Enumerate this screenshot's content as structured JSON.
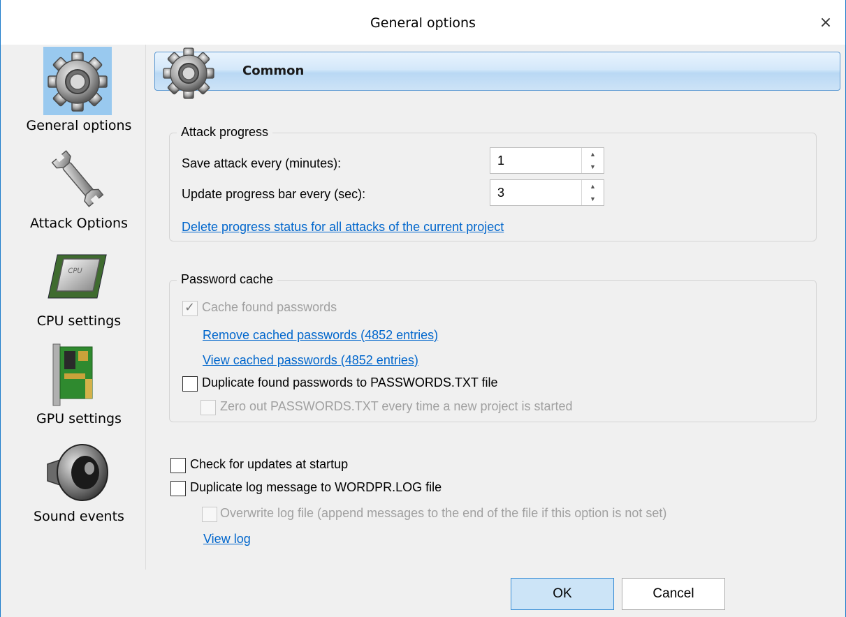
{
  "window": {
    "title": "General options",
    "close_glyph": "×"
  },
  "sidebar": {
    "items": [
      {
        "label": "General options",
        "icon": "gear-icon",
        "selected": true
      },
      {
        "label": "Attack Options",
        "icon": "wrench-icon",
        "selected": false
      },
      {
        "label": "CPU settings",
        "icon": "cpu-chip-icon",
        "selected": false
      },
      {
        "label": "GPU settings",
        "icon": "gpu-card-icon",
        "selected": false
      },
      {
        "label": "Sound events",
        "icon": "speaker-icon",
        "selected": false
      }
    ]
  },
  "header": {
    "title": "Common",
    "icon": "gear-icon"
  },
  "attack_progress": {
    "legend": "Attack progress",
    "save_label": "Save attack every (minutes):",
    "save_value": "1",
    "update_label": "Update progress bar every (sec):",
    "update_value": "3",
    "delete_link": "Delete progress status for all attacks of the current project"
  },
  "password_cache": {
    "legend": "Password cache",
    "cache_found_label": "Cache found passwords",
    "cache_found_checked": true,
    "remove_link": "Remove cached passwords (4852 entries)",
    "view_link": "View cached passwords  (4852 entries)",
    "duplicate_label": "Duplicate found passwords to PASSWORDS.TXT file",
    "zero_out_label": "Zero out PASSWORDS.TXT every time a new project is started"
  },
  "misc": {
    "check_updates_label": "Check for updates at startup",
    "duplicate_log_label": "Duplicate log message to WORDPR.LOG file",
    "overwrite_log_label": "Overwrite log file (append messages to the end of the file if this option is not set)",
    "view_log_link": "View log"
  },
  "footer": {
    "ok_label": "OK",
    "cancel_label": "Cancel"
  },
  "colors": {
    "accent": "#1979ca",
    "link": "#0066cc",
    "selected_bg": "#99c9ef"
  }
}
